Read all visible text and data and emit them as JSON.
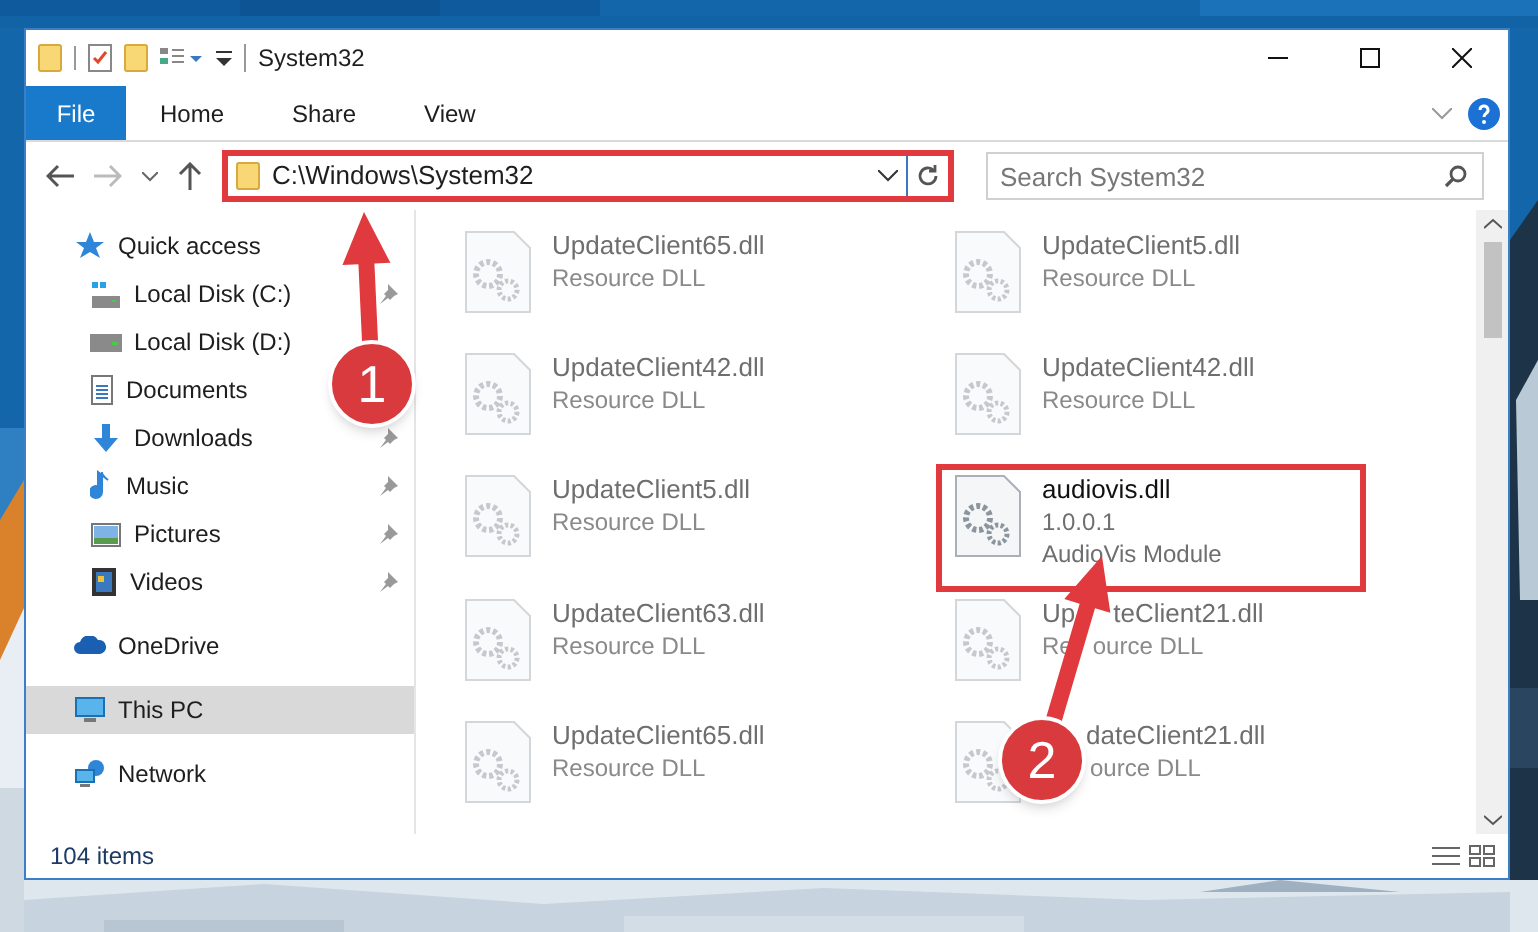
{
  "window": {
    "title": "System32"
  },
  "ribbon_tabs": [
    {
      "label": "File",
      "kind": "file",
      "selected": false
    },
    {
      "label": "Home",
      "kind": "tab",
      "selected": false
    },
    {
      "label": "Share",
      "kind": "tab",
      "selected": false
    },
    {
      "label": "View",
      "kind": "tab",
      "selected": false
    }
  ],
  "address_bar": {
    "path": "C:\\Windows\\System32"
  },
  "search": {
    "placeholder": "Search System32"
  },
  "navigation": [
    {
      "label": "Quick access",
      "kind": "star",
      "selected": false,
      "children": [
        {
          "label": "Local Disk (C:)",
          "kind": "system-drive",
          "pinned": true
        },
        {
          "label": "Local Disk (D:)",
          "kind": "drive"
        },
        {
          "label": "Documents",
          "kind": "documents"
        },
        {
          "label": "Downloads",
          "kind": "downloads",
          "pinned": true
        },
        {
          "label": "Music",
          "kind": "music",
          "pinned": true
        },
        {
          "label": "Pictures",
          "kind": "pictures",
          "pinned": true
        },
        {
          "label": "Videos",
          "kind": "videos",
          "pinned": true
        }
      ]
    },
    {
      "label": "OneDrive",
      "kind": "cloud",
      "selected": false
    },
    {
      "label": "This PC",
      "kind": "pc",
      "selected": true
    },
    {
      "label": "Network",
      "kind": "network",
      "selected": false
    }
  ],
  "files": [
    {
      "name": [
        "UpdateClient65.dll"
      ],
      "details": [
        [
          "Resource DLL"
        ]
      ],
      "blurred": true,
      "highlighted": false
    },
    {
      "name": [
        "UpdateClient5.dll"
      ],
      "details": [
        [
          "Resource DLL"
        ]
      ],
      "blurred": true,
      "highlighted": false
    },
    {
      "name": [
        "UpdateClient42.dll"
      ],
      "details": [
        [
          "Resource DLL"
        ]
      ],
      "blurred": true,
      "highlighted": false
    },
    {
      "name": [
        "UpdateClient42.dll"
      ],
      "details": [
        [
          "Resource DLL"
        ]
      ],
      "blurred": true,
      "highlighted": false
    },
    {
      "name": [
        "UpdateClient5.dll"
      ],
      "details": [
        [
          "Resource DLL"
        ]
      ],
      "blurred": true,
      "highlighted": false
    },
    {
      "name": [
        "audiovis.dll"
      ],
      "details": [
        [
          "1.0.0.1"
        ],
        [
          "AudioVis Module"
        ]
      ],
      "blurred": false,
      "highlighted": true
    },
    {
      "name": [
        "UpdateClient63.dll"
      ],
      "details": [
        [
          "Resource DLL"
        ]
      ],
      "blurred": true,
      "highlighted": false
    },
    {
      "name": [
        "Up",
        "teClient21.dll"
      ],
      "details": [
        [
          "Re",
          "ource DLL"
        ]
      ],
      "blurred": true,
      "highlighted": false
    },
    {
      "name": [
        "UpdateClient65.dll"
      ],
      "details": [
        [
          "Resource DLL"
        ]
      ],
      "blurred": true,
      "highlighted": false
    },
    {
      "name": [
        "dateClient21.dll"
      ],
      "details": [
        [
          "ource DLL"
        ]
      ],
      "blurred": true,
      "highlighted": false
    }
  ],
  "status_bar": {
    "item_count": "104 items"
  },
  "callouts": [
    {
      "number": "1"
    },
    {
      "number": "2"
    }
  ]
}
